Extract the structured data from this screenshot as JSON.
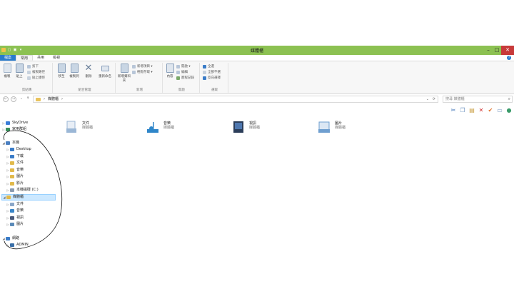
{
  "window": {
    "title": "媒體櫃",
    "quick_access": [
      "▢",
      "▣",
      "▾"
    ]
  },
  "tabs": [
    {
      "label": "檔案",
      "type": "file"
    },
    {
      "label": "常用",
      "type": "active"
    },
    {
      "label": "共用",
      "type": "normal"
    },
    {
      "label": "檢視",
      "type": "normal"
    }
  ],
  "ribbon": {
    "groups": [
      {
        "name": "剪貼簿",
        "big": [
          {
            "label": "複製"
          },
          {
            "label": "貼上"
          }
        ],
        "small": [
          {
            "label": "剪下"
          },
          {
            "label": "複製路徑"
          },
          {
            "label": "貼上捷徑"
          }
        ]
      },
      {
        "name": "組合管理",
        "big": [
          {
            "label": "移至"
          },
          {
            "label": "複製到"
          },
          {
            "label": "刪除"
          },
          {
            "label": "重新命名"
          }
        ]
      },
      {
        "name": "新增",
        "big": [
          {
            "label": "新增資料夾"
          }
        ],
        "small": [
          {
            "label": "新增項目 ▾"
          },
          {
            "label": "輕鬆存取 ▾"
          }
        ]
      },
      {
        "name": "開啟",
        "big": [
          {
            "label": "內容"
          }
        ],
        "small": [
          {
            "label": "開啟 ▾"
          },
          {
            "label": "編輯"
          },
          {
            "label": "歷程記錄"
          }
        ]
      },
      {
        "name": "選取",
        "small": [
          {
            "label": "全選"
          },
          {
            "label": "全部不選"
          },
          {
            "label": "反向選擇"
          }
        ]
      }
    ]
  },
  "address": {
    "back": "←",
    "forward": "→",
    "up": "↑",
    "path": "媒體櫃",
    "separator": "›",
    "refresh": "⟳",
    "dropdown": "⌄",
    "search_placeholder": "搜尋 媒體櫃",
    "search_icon": "⌕"
  },
  "toolbar_icons": [
    {
      "glyph": "✂",
      "color": "#3a6fb5"
    },
    {
      "glyph": "❐",
      "color": "#6a8fbf"
    },
    {
      "glyph": "▤",
      "color": "#c79a3a"
    },
    {
      "glyph": "✕",
      "color": "#d02b2b"
    },
    {
      "glyph": "✔",
      "color": "#e0702a"
    },
    {
      "glyph": "▭",
      "color": "#7a9ac0"
    },
    {
      "glyph": "●",
      "color": "#3b9b6a"
    }
  ],
  "nav": [
    {
      "label": "SkyDrive",
      "arrow": "▷",
      "indent": 0,
      "color": "#3b7dd8"
    },
    {
      "label": "家用群組",
      "arrow": "▷",
      "indent": 0,
      "color": "#3a8f5a"
    },
    {
      "label": "本機",
      "arrow": "◢",
      "indent": 0,
      "color": "#4a7fc1"
    },
    {
      "label": "Desktop",
      "arrow": "▷",
      "indent": 1,
      "color": "#3a7cc8"
    },
    {
      "label": "下載",
      "arrow": "▷",
      "indent": 1,
      "color": "#3a7cc8"
    },
    {
      "label": "文件",
      "arrow": "▷",
      "indent": 1,
      "color": "#e1b94a"
    },
    {
      "label": "音樂",
      "arrow": "▷",
      "indent": 1,
      "color": "#e1b94a"
    },
    {
      "label": "圖片",
      "arrow": "▷",
      "indent": 1,
      "color": "#e1b94a"
    },
    {
      "label": "影片",
      "arrow": "▷",
      "indent": 1,
      "color": "#e1b94a"
    },
    {
      "label": "本機磁碟 (C:)",
      "arrow": "▷",
      "indent": 1,
      "color": "#8a9bb0"
    },
    {
      "label": "媒體櫃",
      "arrow": "◢",
      "indent": 0,
      "color": "#e1b94a",
      "selected": true
    },
    {
      "label": "文件",
      "arrow": "▷",
      "indent": 1,
      "color": "#8aa6c8"
    },
    {
      "label": "音樂",
      "arrow": "▷",
      "indent": 1,
      "color": "#3a86c8"
    },
    {
      "label": "視訊",
      "arrow": "▷",
      "indent": 1,
      "color": "#4a5a7a"
    },
    {
      "label": "圖片",
      "arrow": "▷",
      "indent": 1,
      "color": "#5a8ab8"
    },
    {
      "label": "網路",
      "arrow": "◢",
      "indent": 0,
      "color": "#3a7cc8"
    },
    {
      "label": "ADMIN",
      "arrow": "▷",
      "indent": 1,
      "color": "#3a6fa8"
    }
  ],
  "libraries": [
    {
      "name": "文件",
      "sub": "媒體櫃",
      "color": "#9bb7d6"
    },
    {
      "name": "音樂",
      "sub": "媒體櫃",
      "color": "#2f86c9"
    },
    {
      "name": "視訊",
      "sub": "媒體櫃",
      "color": "#2c3e5a"
    },
    {
      "name": "圖片",
      "sub": "媒體櫃",
      "color": "#6f9fd0"
    }
  ]
}
